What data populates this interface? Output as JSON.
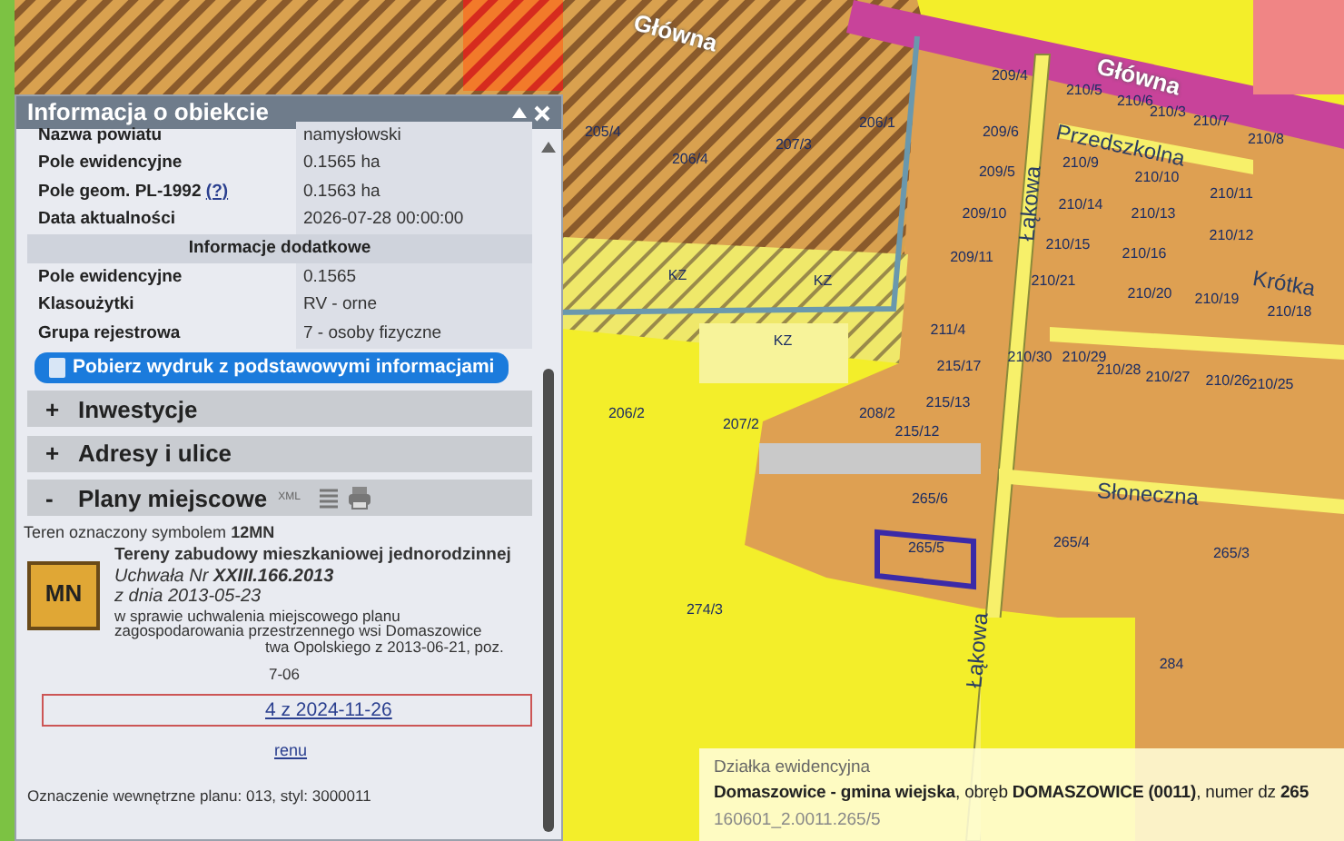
{
  "map": {
    "parcels": [
      "205/4",
      "206/4",
      "207/3",
      "206/1",
      "209/4",
      "209/6",
      "209/5",
      "209/10",
      "209/11",
      "210/5",
      "210/6",
      "210/3",
      "210/7",
      "210/8",
      "210/9",
      "210/10",
      "210/14",
      "210/13",
      "210/11",
      "210/12",
      "210/15",
      "210/16",
      "210/21",
      "210/20",
      "210/19",
      "210/18",
      "211/4",
      "215/17",
      "215/13",
      "210/30",
      "210/29",
      "210/28",
      "210/27",
      "210/26",
      "210/25",
      "206/2",
      "207/2",
      "208/2",
      "215/12",
      "265/6",
      "265/5",
      "265/4",
      "265/3",
      "274/3",
      "284",
      "KZ",
      "KZ",
      "KZ"
    ],
    "streets": [
      "Główna",
      "Główna",
      "Przedszkolna",
      "Krótka",
      "Łąkowa",
      "Łąkowa",
      "Słoneczna"
    ]
  },
  "panel": {
    "title": "Informacja o obiekcie",
    "rows": [
      {
        "label": "Nazwa powiatu",
        "value": "namysłowski"
      },
      {
        "label": "Pole ewidencyjne",
        "value": "0.1565 ha"
      },
      {
        "label": "Pole geom. PL-1992",
        "help": "(?)",
        "value": "0.1563 ha"
      },
      {
        "label": "Data aktualności",
        "value": "2026-07-28 00:00:00"
      }
    ],
    "extra_heading": "Informacje dodatkowe",
    "extra_rows": [
      {
        "label": "Pole ewidencyjne",
        "value": "0.1565"
      },
      {
        "label": "Klasoużytki",
        "value": "RV - orne"
      },
      {
        "label": "Grupa rejestrowa",
        "value": "7 - osoby fizyczne"
      }
    ],
    "print_button": "Pobierz wydruk z podstawowymi informacjami",
    "sections": [
      {
        "symbol": "+",
        "label": "Inwestycje"
      },
      {
        "symbol": "+",
        "label": "Adresy i ulice"
      },
      {
        "symbol": "-",
        "label": "Plany miejscowe",
        "xml": "XML"
      }
    ],
    "plan": {
      "intro": "Teren oznaczony symbolem **12MN**",
      "badge": "MN",
      "title": "Tereny zabudowy mieszkaniowej jednorodzinnej",
      "resolution": "Uchwała Nr **XXIII.166.2013**",
      "date": "z dnia 2013-05-23",
      "subject": "w sprawie uchwalenia miejscowego planu zagospodarowania przestrzennego wsi Domaszowice",
      "fragment_1": "twa Opolskiego z 2013-06-21, poz.",
      "fragment_2": "7-06",
      "boxed_link": "4 z 2024-11-26",
      "link": "renu",
      "footer": "Oznaczenie wewnętrzne planu: 013, styl: 3000011"
    }
  },
  "parcel_info": {
    "caption": "Działka ewidencyjna",
    "location": "**Domaszowice - gmina wiejska**, obręb **DOMASZOWICE (0011)**, numer dz **265**",
    "code": "160601_2.0011.265/5"
  }
}
